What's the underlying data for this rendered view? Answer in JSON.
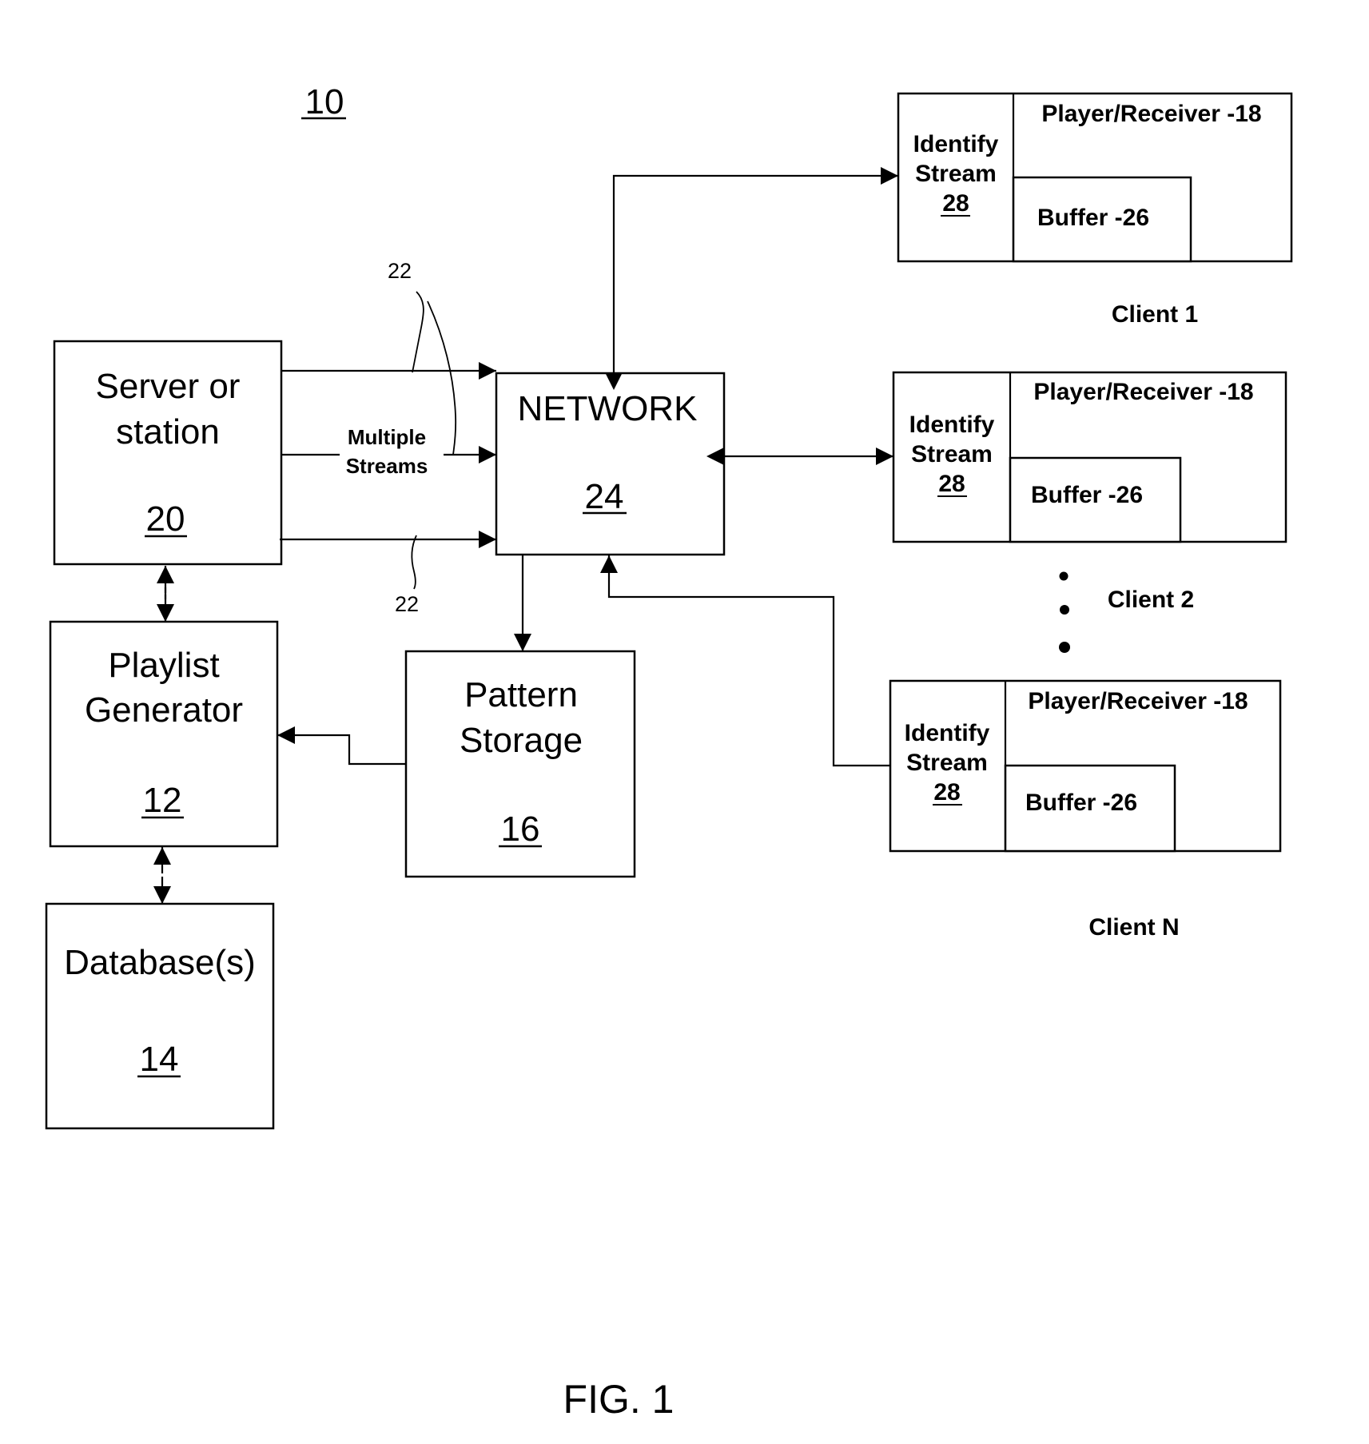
{
  "figure": {
    "reference_number": "10",
    "caption": "FIG. 1"
  },
  "server": {
    "line1": "Server or",
    "line2": "station",
    "ref": "20"
  },
  "network": {
    "label": "NETWORK",
    "ref": "24"
  },
  "playlist": {
    "line1": "Playlist",
    "line2": "Generator",
    "ref": "12"
  },
  "database": {
    "label": "Database(s)",
    "ref": "14"
  },
  "pattern": {
    "line1": "Pattern",
    "line2": "Storage",
    "ref": "16"
  },
  "streams": {
    "label_line1": "Multiple",
    "label_line2": "Streams",
    "ref_top": "22",
    "ref_bottom": "22"
  },
  "clients": [
    {
      "name": "Client 1",
      "identify_line1": "Identify",
      "identify_line2": "Stream",
      "identify_ref": "28",
      "player": "Player/Receiver -18",
      "buffer": "Buffer -26"
    },
    {
      "name": "Client 2",
      "identify_line1": "Identify",
      "identify_line2": "Stream",
      "identify_ref": "28",
      "player": "Player/Receiver -18",
      "buffer": "Buffer -26"
    },
    {
      "name": "Client N",
      "identify_line1": "Identify",
      "identify_line2": "Stream",
      "identify_ref": "28",
      "player": "Player/Receiver -18",
      "buffer": "Buffer -26"
    }
  ]
}
